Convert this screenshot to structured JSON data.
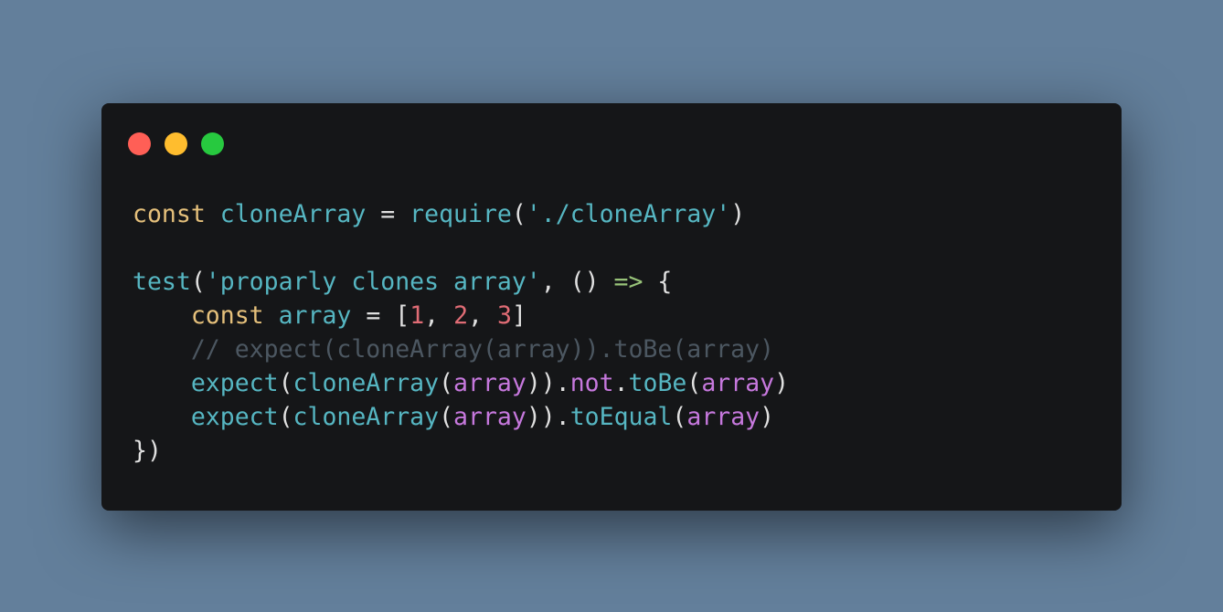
{
  "window": {
    "controls": [
      {
        "name": "close",
        "color": "#ff5f56"
      },
      {
        "name": "minimize",
        "color": "#ffbd2e"
      },
      {
        "name": "maximize",
        "color": "#27c93f"
      }
    ]
  },
  "code": {
    "lines": [
      [
        {
          "t": "const",
          "c": "kw"
        },
        {
          "t": " ",
          "c": "plain"
        },
        {
          "t": "cloneArray",
          "c": "var2"
        },
        {
          "t": " = ",
          "c": "plain"
        },
        {
          "t": "require",
          "c": "fn"
        },
        {
          "t": "(",
          "c": "plain"
        },
        {
          "t": "'./cloneArray'",
          "c": "str"
        },
        {
          "t": ")",
          "c": "plain"
        }
      ],
      [],
      [
        {
          "t": "test",
          "c": "fn"
        },
        {
          "t": "(",
          "c": "plain"
        },
        {
          "t": "'proparly clones array'",
          "c": "str"
        },
        {
          "t": ", () ",
          "c": "plain"
        },
        {
          "t": "=>",
          "c": "arrow"
        },
        {
          "t": " {",
          "c": "plain"
        }
      ],
      [
        {
          "t": "    ",
          "c": "plain"
        },
        {
          "t": "const",
          "c": "kw"
        },
        {
          "t": " ",
          "c": "plain"
        },
        {
          "t": "array",
          "c": "var2"
        },
        {
          "t": " = [",
          "c": "plain"
        },
        {
          "t": "1",
          "c": "num"
        },
        {
          "t": ", ",
          "c": "plain"
        },
        {
          "t": "2",
          "c": "num"
        },
        {
          "t": ", ",
          "c": "plain"
        },
        {
          "t": "3",
          "c": "num"
        },
        {
          "t": "]",
          "c": "plain"
        }
      ],
      [
        {
          "t": "    ",
          "c": "plain"
        },
        {
          "t": "// expect(cloneArray(array)).toBe(array)",
          "c": "cm"
        }
      ],
      [
        {
          "t": "    ",
          "c": "plain"
        },
        {
          "t": "expect",
          "c": "fn"
        },
        {
          "t": "(",
          "c": "plain"
        },
        {
          "t": "cloneArray",
          "c": "fn"
        },
        {
          "t": "(",
          "c": "plain"
        },
        {
          "t": "array",
          "c": "var"
        },
        {
          "t": ")).",
          "c": "plain"
        },
        {
          "t": "not",
          "c": "var"
        },
        {
          "t": ".",
          "c": "plain"
        },
        {
          "t": "toBe",
          "c": "fn"
        },
        {
          "t": "(",
          "c": "plain"
        },
        {
          "t": "array",
          "c": "var"
        },
        {
          "t": ")",
          "c": "plain"
        }
      ],
      [
        {
          "t": "    ",
          "c": "plain"
        },
        {
          "t": "expect",
          "c": "fn"
        },
        {
          "t": "(",
          "c": "plain"
        },
        {
          "t": "cloneArray",
          "c": "fn"
        },
        {
          "t": "(",
          "c": "plain"
        },
        {
          "t": "array",
          "c": "var"
        },
        {
          "t": ")).",
          "c": "plain"
        },
        {
          "t": "toEqual",
          "c": "fn"
        },
        {
          "t": "(",
          "c": "plain"
        },
        {
          "t": "array",
          "c": "var"
        },
        {
          "t": ")",
          "c": "plain"
        }
      ],
      [
        {
          "t": "})",
          "c": "plain"
        }
      ]
    ]
  }
}
